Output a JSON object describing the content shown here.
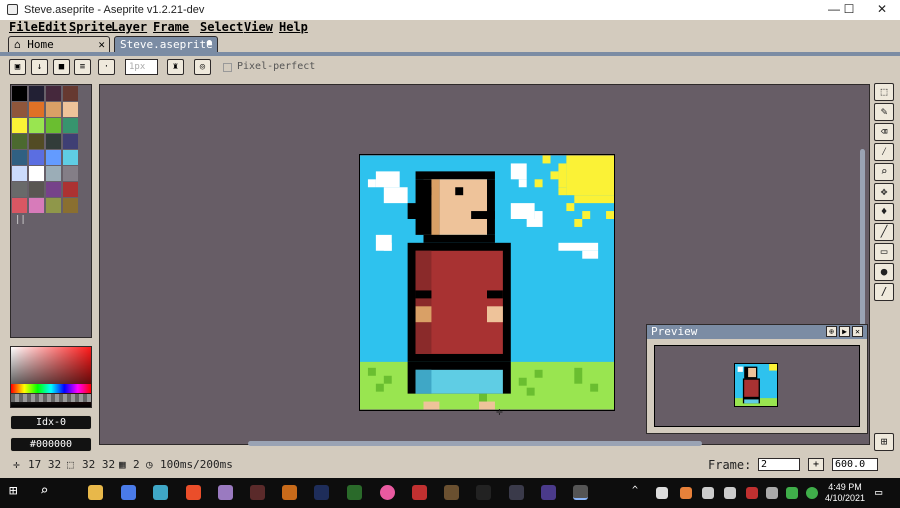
{
  "window": {
    "title": "Steve.aseprite - Aseprite v1.2.21-dev",
    "minimize": "—",
    "maximize": "☐",
    "close": "✕"
  },
  "menu": [
    "File",
    "Edit",
    "Sprite",
    "Layer",
    "Frame",
    "Select",
    "View",
    "Help"
  ],
  "tabs": [
    {
      "label": "Home",
      "icon": "home-icon",
      "close": "✕"
    },
    {
      "label": "Steve.aseprite",
      "modified_dot": "●"
    }
  ],
  "context_bar": {
    "brush_size": "1px",
    "pixel_perfect_label": "Pixel-perfect"
  },
  "palette": {
    "colors": [
      "#000000",
      "#222034",
      "#45283c",
      "#663931",
      "#8f563b",
      "#df7126",
      "#d9a066",
      "#eec39a",
      "#fbf236",
      "#99e550",
      "#6abe30",
      "#37946e",
      "#4b692f",
      "#524b24",
      "#323c39",
      "#3f3f74",
      "#306082",
      "#5b6ee1",
      "#639bff",
      "#5fcde4",
      "#cbdbfc",
      "#ffffff",
      "#9badb7",
      "#847e87",
      "#696a6a",
      "#595652",
      "#76428a",
      "#ac3232",
      "#d95763",
      "#d77bba",
      "#8f974a",
      "#8a6f30"
    ],
    "columns_indicator": "||"
  },
  "color_bar": {
    "index_label": "Idx-0",
    "hex_label": "#000000"
  },
  "preview": {
    "title": "Preview"
  },
  "status": {
    "cursor_pos": "17 32",
    "selection_size": "32 32",
    "frame_num": "2",
    "duration": "100ms/200ms",
    "frame_label": "Frame:",
    "frame_value": "2",
    "frame_plus": "+",
    "zoom": "600.0"
  },
  "taskbar": {
    "time": "4:49 PM",
    "date": "4/10/2021"
  },
  "accent_colors": {
    "panel": "#d3cbbe",
    "editor_bg": "#675d66",
    "tab_active": "#7b8ca4",
    "sky": "#2ec2ee",
    "grass": "#99e550",
    "shirt": "#a83232",
    "skin": "#eec39a"
  }
}
